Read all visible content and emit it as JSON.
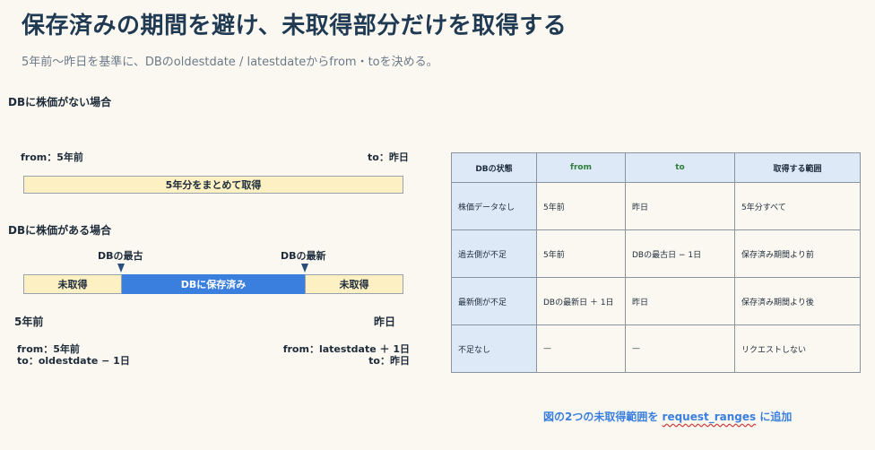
{
  "header": {
    "title": "保存済みの期間を避け、未取得部分だけを取得する",
    "subtitle": "5年前〜昨日を基準に、DBのoldestdate / latestdateからfrom・toを決める。"
  },
  "case_empty": {
    "heading": "DBに株価がない場合",
    "from_label": "from：5年前",
    "to_label": "to：昨日",
    "bar_label": "5年分をまとめて取得"
  },
  "case_present": {
    "heading": "DBに株価がある場合",
    "oldest_label": "DBの最古",
    "latest_label": "DBの最新",
    "seg_left": "未取得",
    "seg_mid": "DBに保存済み",
    "seg_right": "未取得",
    "start_label": "5年前",
    "end_label": "昨日",
    "left_from": "from：5年前",
    "left_to": "to：oldestdate − 1日",
    "right_from": "from：latestdate ＋ 1日",
    "right_to": "to：昨日"
  },
  "table": {
    "headers": [
      "DBの状態",
      "from",
      "to",
      "取得する範囲"
    ],
    "rows": [
      [
        "株価データなし",
        "5年前",
        "昨日",
        "5年分すべて"
      ],
      [
        "過去側が不足",
        "5年前",
        "DBの最古日 − 1日",
        "保存済み期間より前"
      ],
      [
        "最新側が不足",
        "DBの最新日 ＋ 1日",
        "昨日",
        "保存済み期間より後"
      ],
      [
        "不足なし",
        "—",
        "—",
        "リクエストしない"
      ]
    ]
  },
  "note": {
    "prefix": "図の2つの未取得範囲を ",
    "code": "request_ranges",
    "suffix": " に追加"
  },
  "colors": {
    "accent": "#3a7fde",
    "bar_fill": "#fdf1c4",
    "table_header": "#dde9f7",
    "title": "#1f3a52"
  }
}
